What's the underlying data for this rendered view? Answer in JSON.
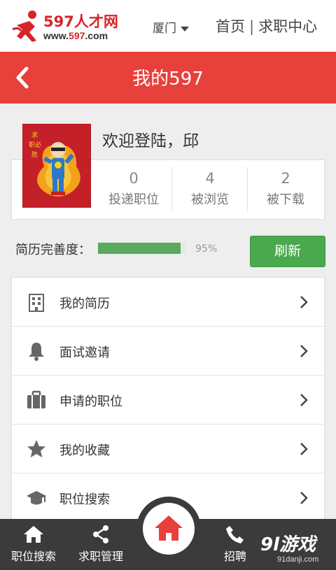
{
  "topbar": {
    "logo_brand": "597人才网",
    "logo_url_prefix": "www.",
    "logo_url_num": "597",
    "logo_url_suffix": ".com",
    "city": "厦门",
    "nav_home": "首页",
    "nav_sep": "|",
    "nav_jobcenter": "求职中心"
  },
  "header": {
    "title": "我的597"
  },
  "profile": {
    "welcome": "欢迎登陆，邱",
    "stats": [
      {
        "value": "0",
        "label": "投递职位"
      },
      {
        "value": "4",
        "label": "被浏览"
      },
      {
        "value": "2",
        "label": "被下载"
      }
    ]
  },
  "completion": {
    "label": "简历完善度：",
    "percent_value": 95,
    "percent_text": "95%",
    "refresh_label": "刷新"
  },
  "menu": {
    "items": [
      {
        "label": "我的简历",
        "icon": "building-icon"
      },
      {
        "label": "面试邀请",
        "icon": "bell-icon"
      },
      {
        "label": "申请的职位",
        "icon": "briefcase-icon"
      },
      {
        "label": "我的收藏",
        "icon": "star-icon"
      },
      {
        "label": "职位搜索",
        "icon": "graduation-cap-icon"
      }
    ]
  },
  "bottomnav": {
    "items": [
      {
        "label": "职位搜索",
        "icon": "home-icon"
      },
      {
        "label": "求职管理",
        "icon": "share-icon"
      },
      {
        "label": "招聘",
        "icon": "phone-icon"
      }
    ],
    "center_icon": "home-icon"
  },
  "watermark": {
    "main": "9l游戏",
    "sub": "91danji.com"
  },
  "colors": {
    "header_red": "#e8403a",
    "brand_red": "#d8232a",
    "progress_green": "#5aa95c",
    "refresh_green": "#4aa84e",
    "bottom_bar": "#3b3b3b"
  }
}
